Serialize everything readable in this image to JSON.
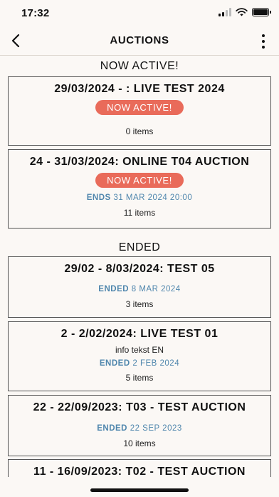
{
  "status_bar": {
    "time": "17:32"
  },
  "nav": {
    "title": "AUCTIONS"
  },
  "sections": {
    "active_title": "NOW ACTIVE!",
    "ended_title": "ENDED"
  },
  "active_auctions": [
    {
      "title": "29/03/2024 - : LIVE TEST 2024",
      "badge": "NOW ACTIVE!",
      "items": "0 items"
    },
    {
      "title": "24 - 31/03/2024: ONLINE T04 AUCTION",
      "badge": "NOW ACTIVE!",
      "ends_label": "ENDS",
      "ends_date": "31 MAR 2024 20:00",
      "items": "11 items"
    }
  ],
  "ended_auctions": [
    {
      "title": "29/02 - 8/03/2024: TEST 05",
      "ended_label": "ENDED",
      "ended_date": "8 MAR 2024",
      "items": "3 items"
    },
    {
      "title": "2 - 2/02/2024: LIVE TEST 01",
      "info": "info tekst EN",
      "ended_label": "ENDED",
      "ended_date": "2 FEB 2024",
      "items": "5 items"
    },
    {
      "title": "22 - 22/09/2023: T03 - TEST AUCTION",
      "ended_label": "ENDED",
      "ended_date": "22 SEP 2023",
      "items": "10 items"
    },
    {
      "title": "11 - 16/09/2023: T02 - TEST AUCTION"
    }
  ],
  "colors": {
    "accent_badge": "#e96b5a",
    "ended_text": "#4f86ad",
    "background": "#fbf8f5"
  },
  "icons": {
    "back": "chevron-left-icon",
    "more": "more-vertical-icon",
    "wifi": "wifi-icon",
    "battery": "battery-icon",
    "signal": "signal-icon"
  }
}
